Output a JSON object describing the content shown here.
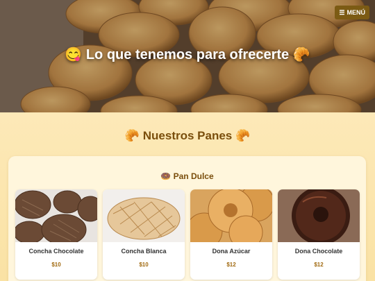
{
  "hero": {
    "title": "😋 Lo que tenemos para ofrecerte 🥐",
    "menu_label": "MENÚ",
    "menu_icon": "hamburger-menu-icon"
  },
  "section": {
    "title": "🥐 Nuestros Panes 🥐",
    "category": "🍩 Pan Dulce"
  },
  "products": [
    {
      "name": "Concha Chocolate",
      "price": "$10"
    },
    {
      "name": "Concha Blanca",
      "price": "$10"
    },
    {
      "name": "Dona Azúcar",
      "price": "$12"
    },
    {
      "name": "Dona Chocolate",
      "price": "$12"
    }
  ],
  "colors": {
    "accent": "#7c5b14",
    "heading": "#7a4e0c",
    "price": "#a0690f",
    "background": "#fbe7b3"
  }
}
